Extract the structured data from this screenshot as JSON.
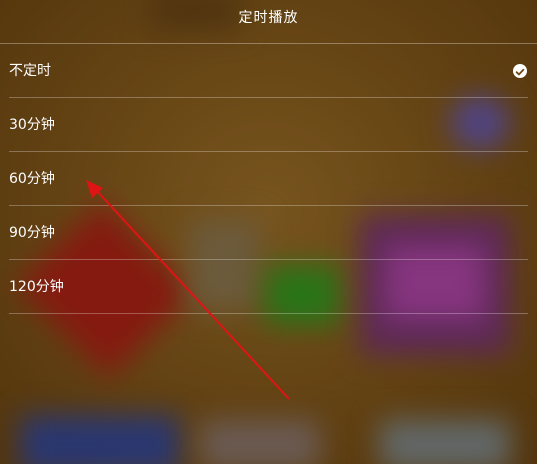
{
  "sheet": {
    "title": "定时播放",
    "options": [
      {
        "label": "不定时",
        "selected": true
      },
      {
        "label": "30分钟",
        "selected": false
      },
      {
        "label": "60分钟",
        "selected": false
      },
      {
        "label": "90分钟",
        "selected": false
      },
      {
        "label": "120分钟",
        "selected": false
      }
    ]
  },
  "icons": {
    "selected_marker": "checkmark-circle-icon"
  },
  "annotation": {
    "arrow_color": "#e01414"
  },
  "colors": {
    "background": "#6e4a16",
    "text": "#ffffff",
    "divider": "rgba(255,255,255,0.3)"
  }
}
